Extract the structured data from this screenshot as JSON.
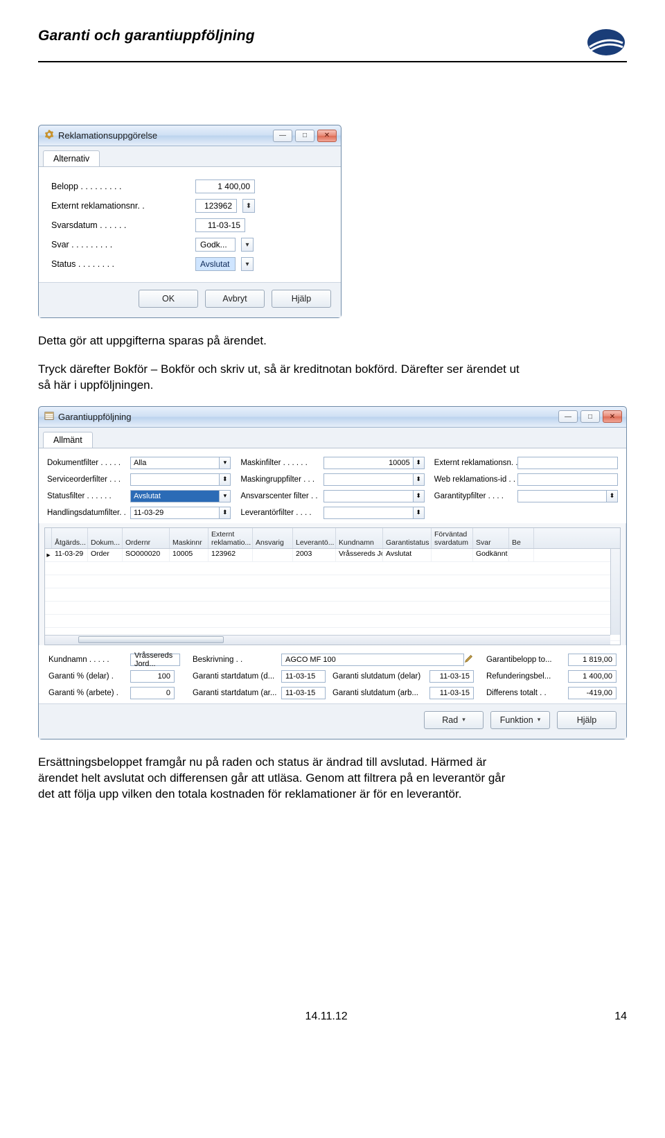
{
  "page": {
    "title": "Garanti och garantiuppföljning",
    "date": "14.11.12",
    "pageno": "14"
  },
  "prose": {
    "p1": "Detta gör att uppgifterna sparas på ärendet.",
    "p2": "Tryck därefter Bokför – Bokför och skriv ut, så är kreditnotan bokförd. Därefter ser ärendet ut så här i uppföljningen.",
    "p3": "Ersättningsbeloppet framgår nu på raden och status är ändrad till avslutad. Härmed är ärendet helt avslutat och differensen går att utläsa. Genom att filtrera på en leverantör går det att följa upp vilken den totala kostnaden för reklamationer är för en leverantör."
  },
  "dlg1": {
    "title": "Reklamationsuppgörelse",
    "tab": "Alternativ",
    "rows": {
      "belopp": {
        "label": "Belopp . . . . . . . . .",
        "value": "1 400,00"
      },
      "extnr": {
        "label": "Externt reklamationsnr. .",
        "value": "123962"
      },
      "svdat": {
        "label": "Svarsdatum . . . . . .",
        "value": "11-03-15"
      },
      "svar": {
        "label": "Svar  . . . . . . . . .",
        "value": "Godk..."
      },
      "status": {
        "label": "Status  . . . . . . . .",
        "value": "Avslutat"
      }
    },
    "buttons": {
      "ok": "OK",
      "cancel": "Avbryt",
      "help": "Hjälp"
    }
  },
  "dlg2": {
    "title": "Garantiuppföljning",
    "tab": "Allmänt",
    "filters": [
      {
        "label": "Dokumentfilter . . . . .",
        "value": "Alla",
        "dd": true
      },
      {
        "label": "Maskinfilter . . . . . .",
        "value": "10005",
        "step": true
      },
      {
        "label": "Externt reklamationsn. .",
        "value": ""
      },
      {
        "label": "Serviceorderfilter  . . .",
        "value": "",
        "step": true
      },
      {
        "label": "Maskingruppfilter  . . .",
        "value": "",
        "step": true
      },
      {
        "label": "Web reklamations-id . .",
        "value": ""
      },
      {
        "label": "Statusfilter . . . . . .",
        "value": "Avslutat",
        "dd": true,
        "hl": true
      },
      {
        "label": "Ansvarscenter filter . .",
        "value": "",
        "step": true
      },
      {
        "label": "Garantitypfilter . . . .",
        "value": "",
        "step": true
      },
      {
        "label": "Handlingsdatumfilter. .",
        "value": "11-03-29",
        "step": true
      },
      {
        "label": "Leverantörfilter . . . .",
        "value": "",
        "step": true
      }
    ],
    "grid": {
      "headers": [
        "Åtgärds...",
        "Dokum...",
        "Ordernr",
        "Maskinnr",
        "Externt reklamatio...",
        "Ansvarig",
        "Leverantö...",
        "Kundnamn",
        "Garantistatus",
        "Förväntad svardatum",
        "Svar",
        "Be"
      ],
      "row": [
        "11-03-29",
        "Order",
        "SO000020",
        "10005",
        "123962",
        "",
        "2003",
        "Vråssereds Jordbru...",
        "Avslutat",
        "",
        "Godkännt",
        ""
      ]
    },
    "detail": {
      "left": [
        {
          "label": "Kundnamn . . . . .",
          "value": "Vråssereds Jord..."
        },
        {
          "label": "Garanti % (delar) .",
          "value": "100"
        },
        {
          "label": "Garanti % (arbete) .",
          "value": "0"
        }
      ],
      "mid": [
        {
          "label": "Beskrivning . .",
          "value": "AGCO MF 100",
          "pencil": true
        },
        {
          "label": "Garanti startdatum (d...",
          "value": "11-03-15",
          "label2": "Garanti slutdatum (delar)",
          "value2": "11-03-15"
        },
        {
          "label": "Garanti startdatum (ar...",
          "value": "11-03-15",
          "label2": "Garanti slutdatum (arb...",
          "value2": "11-03-15"
        }
      ],
      "right": [
        {
          "label": "Garantibelopp to...",
          "value": "1 819,00"
        },
        {
          "label": "Refunderingsbel...",
          "value": "1 400,00"
        },
        {
          "label": "Differens totalt  . .",
          "value": "-419,00"
        }
      ]
    },
    "buttons": {
      "rad": "Rad",
      "funk": "Funktion",
      "help": "Hjälp"
    }
  }
}
